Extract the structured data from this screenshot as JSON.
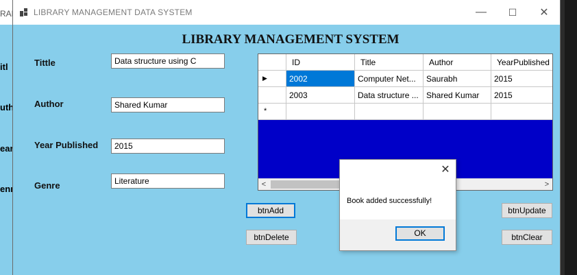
{
  "background_window": {
    "title_fragment": "RAF",
    "label_fragments": [
      "itl",
      "uth",
      "ear",
      "enı"
    ]
  },
  "window": {
    "title": "LIBRARY MANAGEMENT DATA SYSTEM",
    "controls": {
      "minimize": "—",
      "maximize": "☐",
      "close": "✕"
    }
  },
  "form": {
    "heading": "LIBRARY MANAGEMENT SYSTEM",
    "fields": [
      {
        "label": "Tittle",
        "value": "Data structure using C"
      },
      {
        "label": "Author",
        "value": "Shared Kumar"
      },
      {
        "label": "Year Published",
        "value": "2015"
      },
      {
        "label": "Genre",
        "value": "Literature"
      }
    ]
  },
  "grid": {
    "columns": [
      "ID",
      "Title",
      "Author",
      "YearPublished"
    ],
    "rows": [
      {
        "indicator": "▶",
        "cells": [
          "2002",
          "Computer Net...",
          "Saurabh",
          "2015"
        ]
      },
      {
        "indicator": "",
        "cells": [
          "2003",
          "Data structure ...",
          "Shared Kumar",
          "2015"
        ]
      },
      {
        "indicator": "*",
        "cells": [
          "",
          "",
          "",
          ""
        ]
      }
    ],
    "scroll_left": "<",
    "scroll_right": ">"
  },
  "buttons": {
    "add": "btnAdd",
    "delete": "btnDelete",
    "update": "btnUpdate",
    "clear": "btnClear"
  },
  "message_box": {
    "text": "Book added successfully!",
    "ok": "OK",
    "close": "✕"
  },
  "colors": {
    "form_background": "#87ceeb",
    "grid_background": "#0000c8",
    "selection": "#0078d7"
  }
}
